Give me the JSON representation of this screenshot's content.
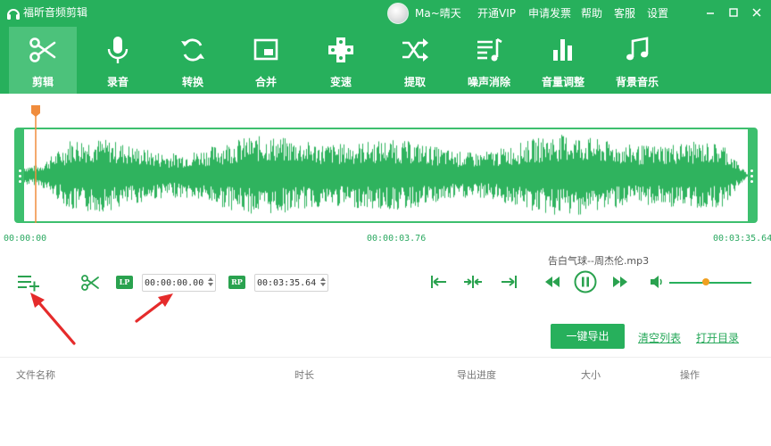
{
  "app": {
    "title": "福昕音频剪辑"
  },
  "user": {
    "name": "Ma~晴天"
  },
  "header_links": [
    "开通VIP",
    "申请发票",
    "帮助",
    "客服",
    "设置"
  ],
  "tools": [
    {
      "label": "剪辑",
      "icon": "scissors-icon",
      "active": true
    },
    {
      "label": "录音",
      "icon": "microphone-icon"
    },
    {
      "label": "转换",
      "icon": "convert-icon"
    },
    {
      "label": "合并",
      "icon": "merge-icon"
    },
    {
      "label": "变速",
      "icon": "speed-icon"
    },
    {
      "label": "提取",
      "icon": "extract-icon"
    },
    {
      "label": "噪声消除",
      "icon": "noise-reduction-icon"
    },
    {
      "label": "音量调整",
      "icon": "volume-adjust-icon"
    },
    {
      "label": "背景音乐",
      "icon": "background-music-icon"
    }
  ],
  "timeline": {
    "start": "00:00:00",
    "mid": "00:00:03.76",
    "end": "00:03:35.64"
  },
  "editor": {
    "lp_label": "LP",
    "rp_label": "RP",
    "start_time": "00:00:00.00",
    "end_time": "00:03:35.64",
    "file_name": "告白气球--周杰伦.mp3",
    "volume": 0.45
  },
  "actions": {
    "export_label": "一键导出",
    "clear_label": "清空列表",
    "open_dir_label": "打开目录"
  },
  "table": {
    "columns": [
      "文件名称",
      "时长",
      "导出进度",
      "大小",
      "操作"
    ]
  },
  "colors": {
    "brand": "#27b05c",
    "waveform": "#2fb35e",
    "playhead": "#f08c3c",
    "volume_knob": "#f0a020"
  }
}
